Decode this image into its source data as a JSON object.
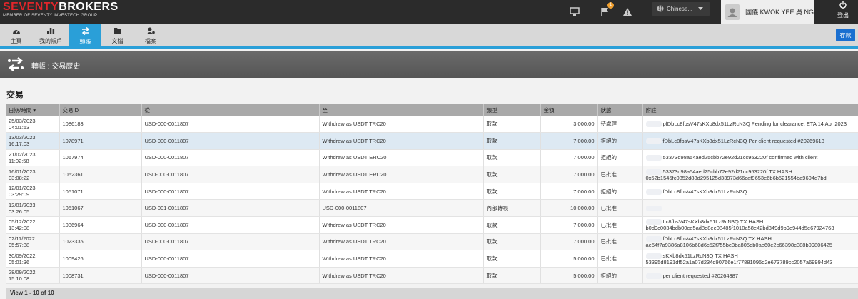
{
  "brand": {
    "logo_red": "SEVENTY",
    "logo_white": "BROKERS",
    "tagline": "MEMBER OF SEVENTY INVESTECH GROUP"
  },
  "topbar": {
    "notification_count": "1",
    "language": "Chinese...",
    "user_name": "國儀 KWOK YEE 吳 NG",
    "logout_label": "登出"
  },
  "nav": {
    "items": [
      "主頁",
      "我的帳戶",
      "轉賬",
      "文檔",
      "檔案"
    ],
    "save_label": "存款"
  },
  "page": {
    "title": "轉帳 : 交易歷史",
    "section_title": "交易"
  },
  "table": {
    "headers": [
      "日期/時間",
      "交易ID",
      "從",
      "至",
      "類型",
      "金額",
      "狀態",
      "附註"
    ],
    "rows": [
      {
        "date": "25/03/2023",
        "time": "04:01:53",
        "id": "1086183",
        "from": "USD-000-0011807",
        "to": "Withdraw as USDT TRC20",
        "type": "取款",
        "amount": "3,000.00",
        "status": "待處理",
        "note1": "pfDbLc8fbsV47sKXb8dx51LzRcN3Q Pending for clearance, ETA 14 Apr 2023",
        "note2": ""
      },
      {
        "date": "13/03/2023",
        "time": "16:17:03",
        "id": "1078971",
        "from": "USD-000-0011807",
        "to": "Withdraw as USDT TRC20",
        "type": "取款",
        "amount": "7,000.00",
        "status": "拒絕的",
        "note1": "fDbLc8fbsV47sKXb8dx51LzRcN3Q Per client requested #20269613",
        "note2": ""
      },
      {
        "date": "21/02/2023",
        "time": "11:02:58",
        "id": "1067974",
        "from": "USD-000-0011807",
        "to": "Withdraw as USDT ERC20",
        "type": "取款",
        "amount": "7,000.00",
        "status": "拒絕的",
        "note1": "53373d98a54aed25cbb72e92d21cc953220f confirmed with client",
        "note2": ""
      },
      {
        "date": "16/01/2023",
        "time": "03:08:22",
        "id": "1052361",
        "from": "USD-000-0011807",
        "to": "Withdraw as USDT ERC20",
        "type": "取款",
        "amount": "7,000.00",
        "status": "已批准",
        "note1": "53373d98a54aed25cbb72e92d21cc953220f TX HASH",
        "note2": "0x52b1545fc0852d88d295125d33973d66caf9653e6b6b521554ba9604d7bd"
      },
      {
        "date": "12/01/2023",
        "time": "03:29:09",
        "id": "1051071",
        "from": "USD-000-0011807",
        "to": "Withdraw as USDT TRC20",
        "type": "取款",
        "amount": "7,000.00",
        "status": "拒絕的",
        "note1": "fDbLc8fbsV47sKXb8dx51LzRcN3Q",
        "note2": ""
      },
      {
        "date": "12/01/2023",
        "time": "03:26:05",
        "id": "1051067",
        "from": "USD-001-0011807",
        "to": "USD-000-0011807",
        "type": "內部轉賬",
        "amount": "10,000.00",
        "status": "已批准",
        "note1": "",
        "note2": ""
      },
      {
        "date": "05/12/2022",
        "time": "13:42:08",
        "id": "1036964",
        "from": "USD-000-0011807",
        "to": "Withdraw as USDT TRC20",
        "type": "取款",
        "amount": "7,000.00",
        "status": "已批准",
        "note1": "Lc8fbsV47sKXb8dx51LzRcN3Q TX HASH",
        "note2": "b0d9c0034bdb00ce5ad8d8ee08485f1010a58e42bd349d9b9e944d5e67924763"
      },
      {
        "date": "02/11/2022",
        "time": "05:57:38",
        "id": "1023335",
        "from": "USD-000-0011807",
        "to": "Withdraw as USDT TRC20",
        "type": "取款",
        "amount": "7,000.00",
        "status": "已批准",
        "note1": "fDbLc8fbsV47sKXb8dx51LzRcN3Q TX HASH",
        "note2": "ae54f7a9386a8106b68d6c52f755be3ba805db0ae60e2c66398c388b09806425"
      },
      {
        "date": "30/09/2022",
        "time": "05:01:36",
        "id": "1009426",
        "from": "USD-000-0011807",
        "to": "Withdraw as USDT TRC20",
        "type": "取款",
        "amount": "5,000.00",
        "status": "已批准",
        "note1": "sKXb8dx51LzRcN3Q TX HASH",
        "note2": "53395d8191df52a1a07d234d90766e1f77881095d2e673789cc2057a69994d43"
      },
      {
        "date": "28/09/2022",
        "time": "15:10:08",
        "id": "1008731",
        "from": "USD-000-0011807",
        "to": "Withdraw as USDT TRC20",
        "type": "取款",
        "amount": "5,000.00",
        "status": "拒絕的",
        "note1": "per client requested #20264387",
        "note2": ""
      }
    ],
    "footer": "View 1 - 10 of 10"
  },
  "colors": {
    "accent": "#2a9fd8",
    "save_button": "#1a6fd0",
    "selected_row": "#dde9f3",
    "logo_red": "#e0262b"
  },
  "icons": [
    "monitor-icon",
    "flag-icon",
    "warning-icon",
    "globe-icon",
    "power-icon",
    "dashboard-icon",
    "bar-chart-icon",
    "transfer-icon",
    "folder-icon",
    "user-settings-icon"
  ]
}
